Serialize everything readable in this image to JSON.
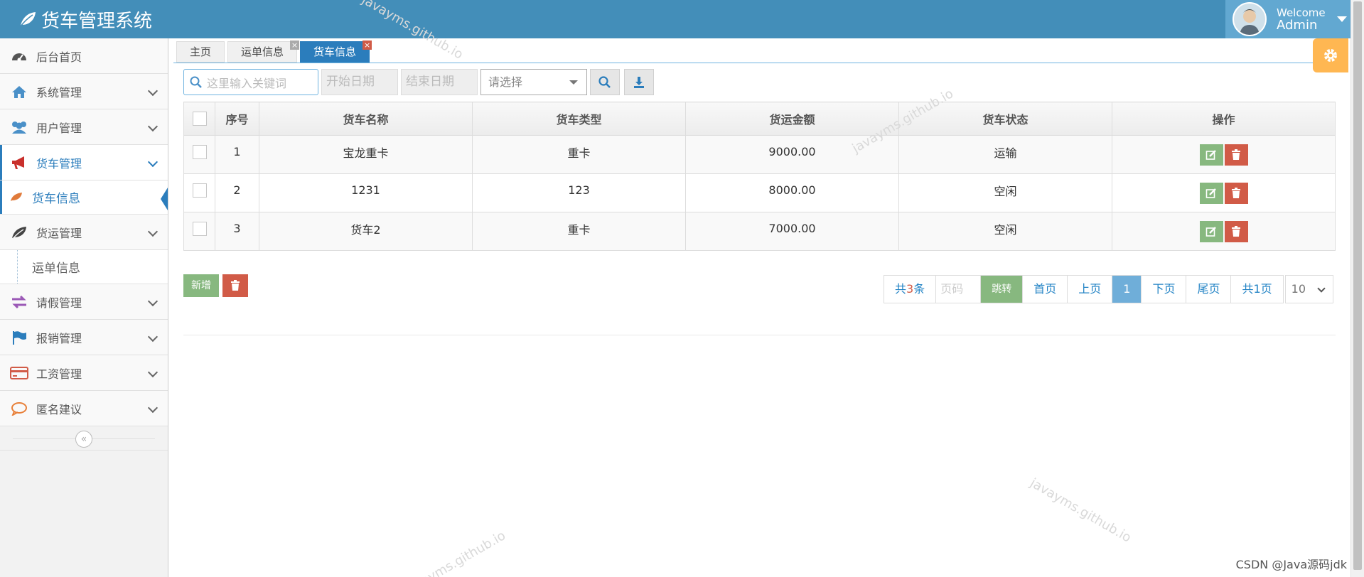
{
  "app": {
    "title": "货车管理系统"
  },
  "user": {
    "welcome": "Welcome",
    "name": "Admin"
  },
  "sidebar": {
    "items": [
      {
        "label": "后台首页",
        "icon": "dashboard-icon"
      },
      {
        "label": "系统管理",
        "icon": "home-icon"
      },
      {
        "label": "用户管理",
        "icon": "users-icon"
      },
      {
        "label": "货车管理",
        "icon": "bullhorn-icon"
      },
      {
        "label": "货车信息",
        "icon": "leaf-icon"
      },
      {
        "label": "货运管理",
        "icon": "leaf-icon"
      },
      {
        "label": "运单信息"
      },
      {
        "label": "请假管理",
        "icon": "exchange-icon"
      },
      {
        "label": "报销管理",
        "icon": "flag-icon"
      },
      {
        "label": "工资管理",
        "icon": "credit-card-icon"
      },
      {
        "label": "匿名建议",
        "icon": "comment-icon"
      }
    ]
  },
  "tabs": [
    {
      "label": "主页"
    },
    {
      "label": "运单信息",
      "close": "×"
    },
    {
      "label": "货车信息",
      "close": "×"
    }
  ],
  "toolbar": {
    "search_placeholder": "这里输入关键词",
    "start_date": "开始日期",
    "end_date": "结束日期",
    "select_value": "请选择"
  },
  "table": {
    "headers": [
      "序号",
      "货车名称",
      "货车类型",
      "货运金额",
      "货车状态",
      "操作"
    ],
    "rows": [
      {
        "no": "1",
        "name": "宝龙重卡",
        "type": "重卡",
        "amount": "9000.00",
        "status": "运输"
      },
      {
        "no": "2",
        "name": "1231",
        "type": "123",
        "amount": "8000.00",
        "status": "空闲"
      },
      {
        "no": "3",
        "name": "货车2",
        "type": "重卡",
        "amount": "7000.00",
        "status": "空闲"
      }
    ]
  },
  "actions": {
    "add": "新增"
  },
  "pager": {
    "total_prefix": "共",
    "total_count": "3",
    "total_suffix": "条",
    "page_input_placeholder": "页码",
    "jump": "跳转",
    "first": "首页",
    "prev": "上页",
    "current": "1",
    "next": "下页",
    "last": "尾页",
    "pages": "共1页",
    "page_size": "10"
  },
  "watermarks": [
    "javayms.github.io",
    "javayms.github.io",
    "javayms.github.io",
    "javayms.github.io"
  ],
  "footer": "CSDN @Java源码jdk",
  "colors": {
    "header": "#438eb9",
    "primary": "#2b7dbc",
    "success": "#87b87f",
    "danger": "#d15b47",
    "warning": "#ffb752"
  }
}
